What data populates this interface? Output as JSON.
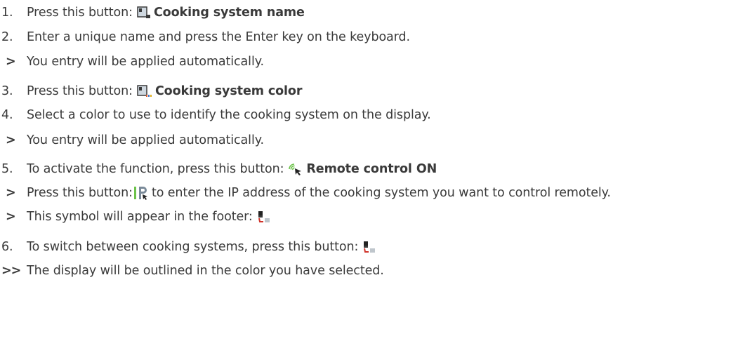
{
  "steps": [
    {
      "marker": "1.",
      "text": "Press this button:",
      "icon": "cooking-system-name-icon",
      "bold": "Cooking system name"
    },
    {
      "marker": "2.",
      "text": "Enter a unique name and press the Enter key on the keyboard."
    },
    {
      "marker": ">",
      "text": "You entry will be applied automatically."
    },
    {
      "marker": "3.",
      "text": "Press this button:",
      "icon": "cooking-system-color-icon",
      "bold": "Cooking system color"
    },
    {
      "marker": "4.",
      "text": "Select a color to use to identify the cooking system on the display."
    },
    {
      "marker": ">",
      "text": "You entry will be applied automatically."
    },
    {
      "marker": "5.",
      "text": "To activate the function, press this button:",
      "icon": "remote-control-icon",
      "bold": "Remote control ON"
    },
    {
      "marker": ">",
      "text_before": "Press this button:",
      "icon": "ip-address-icon",
      "text_after": "to enter the IP address of the cooking system you want to control remotely."
    },
    {
      "marker": ">",
      "text": "This symbol will appear in the footer:",
      "icon": "remote-footer-symbol-icon"
    },
    {
      "marker": "6.",
      "text": "To switch between cooking systems, press this button:",
      "icon": "switch-cooking-system-icon"
    },
    {
      "marker": ">>",
      "text": "The display will be outlined in the color you have selected."
    }
  ],
  "colors": {
    "text": "#3a3a3a",
    "remote_green": "#6cc24a",
    "remote_red": "#d0332a"
  }
}
